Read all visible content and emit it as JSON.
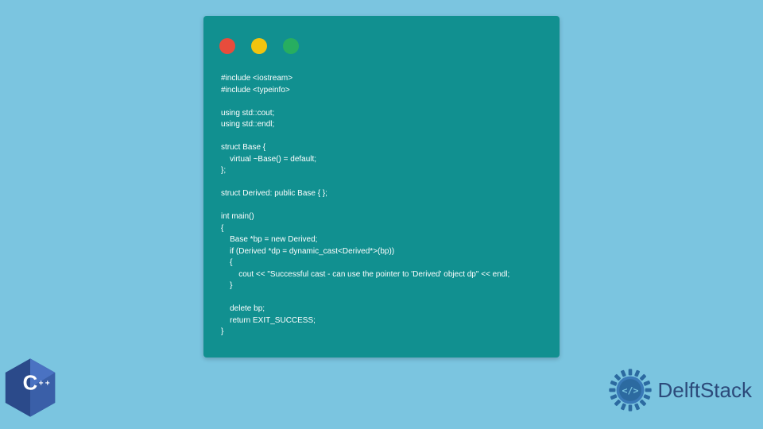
{
  "window": {
    "lights": [
      "red",
      "yellow",
      "green"
    ]
  },
  "code": {
    "text": "#include <iostream>\n#include <typeinfo>\n\nusing std::cout;\nusing std::endl;\n\nstruct Base {\n    virtual ~Base() = default;\n};\n\nstruct Derived: public Base { };\n\nint main()\n{\n    Base *bp = new Derived;\n    if (Derived *dp = dynamic_cast<Derived*>(bp))\n    {\n        cout << \"Successful cast - can use the pointer to 'Derived' object dp\" << endl;\n    }\n\n    delete bp;\n    return EXIT_SUCCESS;\n}"
  },
  "cpp_badge": {
    "label": "C++"
  },
  "brand": {
    "name": "DelftStack"
  },
  "colors": {
    "background": "#7bc5e0",
    "window": "#119090",
    "cpp_badge": "#2b4a8a",
    "brand_text": "#2c4a7a"
  }
}
